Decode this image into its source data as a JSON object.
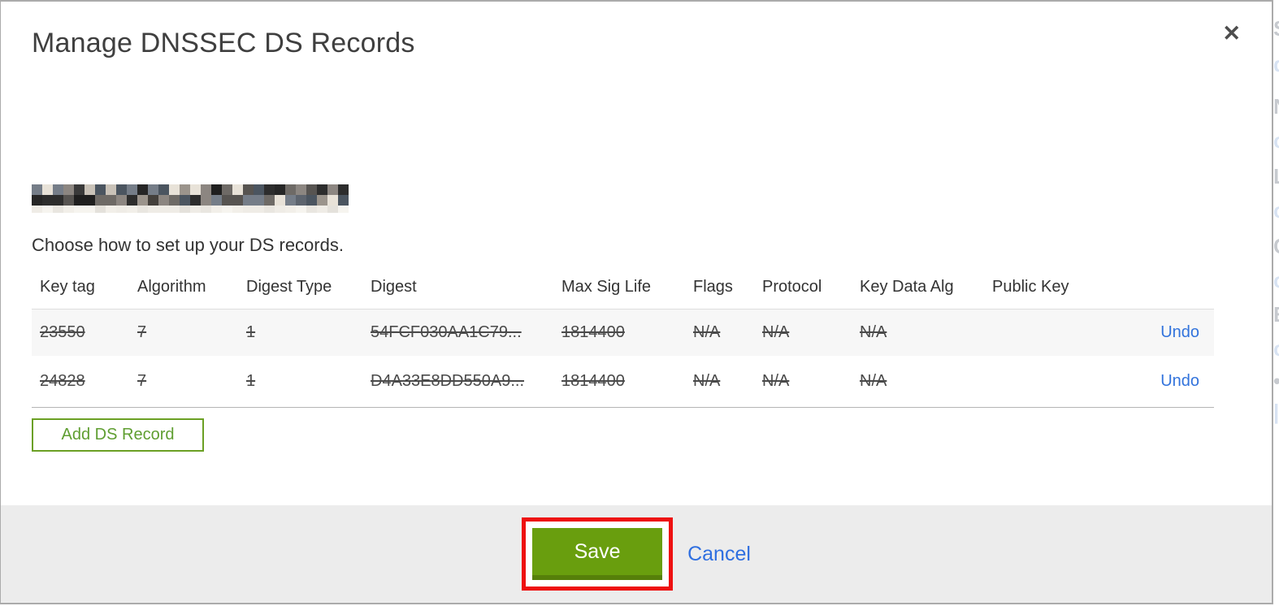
{
  "modal": {
    "title": "Manage DNSSEC DS Records",
    "close_glyph": "✕",
    "domain": {
      "redacted": true
    },
    "instruction": "Choose how to set up your DS records.",
    "table": {
      "columns": [
        "Key tag",
        "Algorithm",
        "Digest Type",
        "Digest",
        "Max Sig Life",
        "Flags",
        "Protocol",
        "Key Data Alg",
        "Public Key"
      ],
      "rows": [
        {
          "key_tag": "23550",
          "algorithm": "7",
          "digest_type": "1",
          "digest": "54FCF030AA1C79...",
          "max_sig_life": "1814400",
          "flags": "N/A",
          "protocol": "N/A",
          "key_data_alg": "N/A",
          "public_key": "",
          "action": "Undo",
          "struck": true
        },
        {
          "key_tag": "24828",
          "algorithm": "7",
          "digest_type": "1",
          "digest": "D4A33E8DD550A9...",
          "max_sig_life": "1814400",
          "flags": "N/A",
          "protocol": "N/A",
          "key_data_alg": "N/A",
          "public_key": "",
          "action": "Undo",
          "struck": true
        }
      ]
    },
    "add_button_label": "Add DS Record",
    "save_button_label": "Save",
    "cancel_link_label": "Cancel"
  },
  "background_page": {
    "fragments": [
      "S",
      "d",
      "N",
      "o",
      "L",
      "o",
      "C",
      "o",
      "E",
      "o",
      "•",
      "|"
    ]
  },
  "colors": {
    "green": "#699e0e",
    "green_dark": "#567f0a",
    "green_outline": "#6ba024",
    "link_blue": "#3273dc",
    "annotation_red": "#ee1111",
    "footer_bg": "#ececec",
    "row_alt_bg": "#f7f7f7"
  }
}
